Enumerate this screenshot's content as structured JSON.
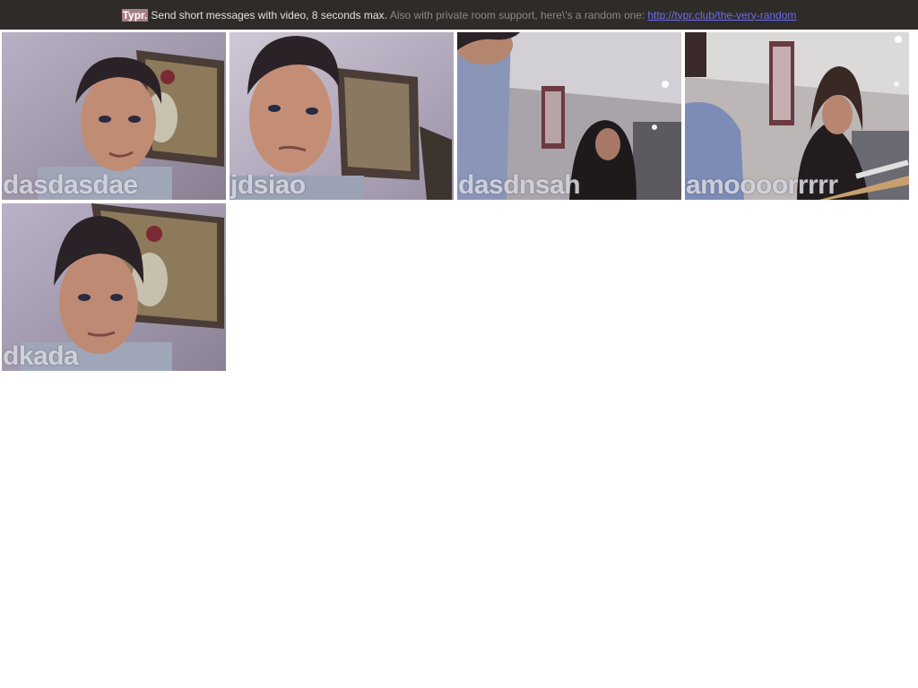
{
  "header": {
    "brand": "Typr.",
    "tagline": "Send short messages with video, 8 seconds max.",
    "note": "Also with private room support, here\\'s a random one:",
    "link_text": "http://typr.club/the-very-random"
  },
  "messages": [
    {
      "username": "dasdasdae",
      "scene": "man-closeup-painting"
    },
    {
      "username": "jdsiao",
      "scene": "man-closeup-tilted"
    },
    {
      "username": "dasdnsah",
      "scene": "room-woman-left"
    },
    {
      "username": "amoooorrrrr",
      "scene": "woman-guitar"
    },
    {
      "username": "dkada",
      "scene": "man-closeup-painting"
    }
  ]
}
